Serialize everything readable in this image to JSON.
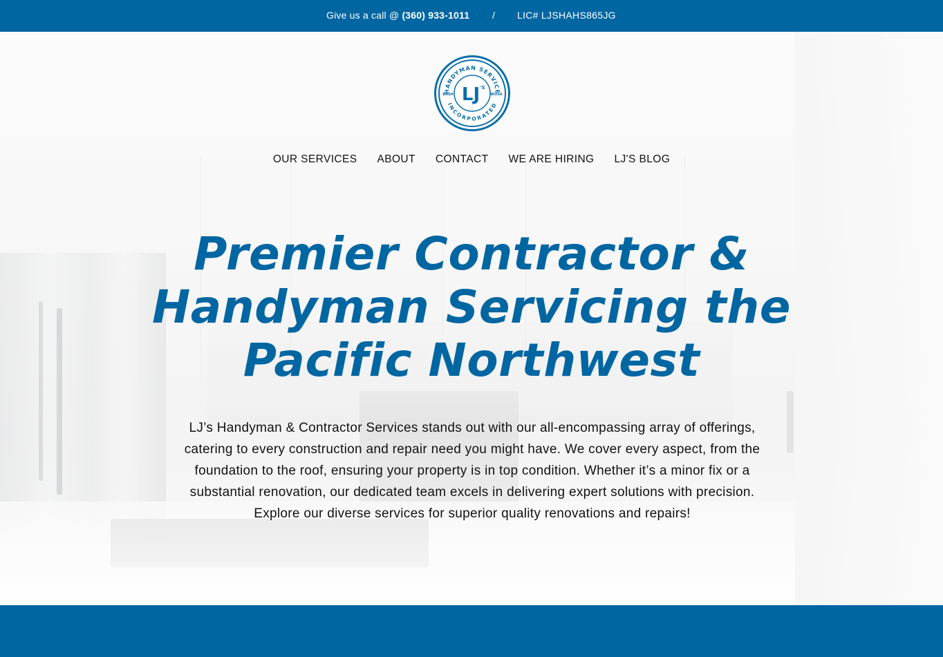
{
  "topbar": {
    "call_prefix": "Give us a call @ ",
    "phone": "(360) 933-1011",
    "separator": "/",
    "license": "LIC# LJSHAHS865JG",
    "bg_color": "#0066a2"
  },
  "logo": {
    "alt": "LJ's Handyman Service Incorporated logo",
    "ring_top_text": "HANDYMAN SERVICE",
    "ring_bottom_text": "INCORPORATED",
    "left_text": "BASH",
    "right_text": "WOSA",
    "monogram": "LJ",
    "monogram_suffix": "'S",
    "color": "#0b6ea8"
  },
  "nav": {
    "items": [
      {
        "label": "OUR SERVICES"
      },
      {
        "label": "ABOUT"
      },
      {
        "label": "CONTACT"
      },
      {
        "label": "WE ARE HIRING"
      },
      {
        "label": "LJ'S BLOG"
      }
    ]
  },
  "hero": {
    "headline": "Premier Contractor & Handyman Servicing the Pacific Northwest",
    "intro": "LJ’s Handyman & Contractor Services stands out with our all-encompassing array of offerings, catering to every construction and repair need you might have. We cover every aspect, from the foundation to the roof, ensuring your property is in top condition. Whether it’s a minor fix or a substantial renovation, our dedicated team excels in delivering expert solutions with precision. Explore our diverse services for superior quality renovations and repairs!",
    "headline_color": "#0066a2"
  }
}
